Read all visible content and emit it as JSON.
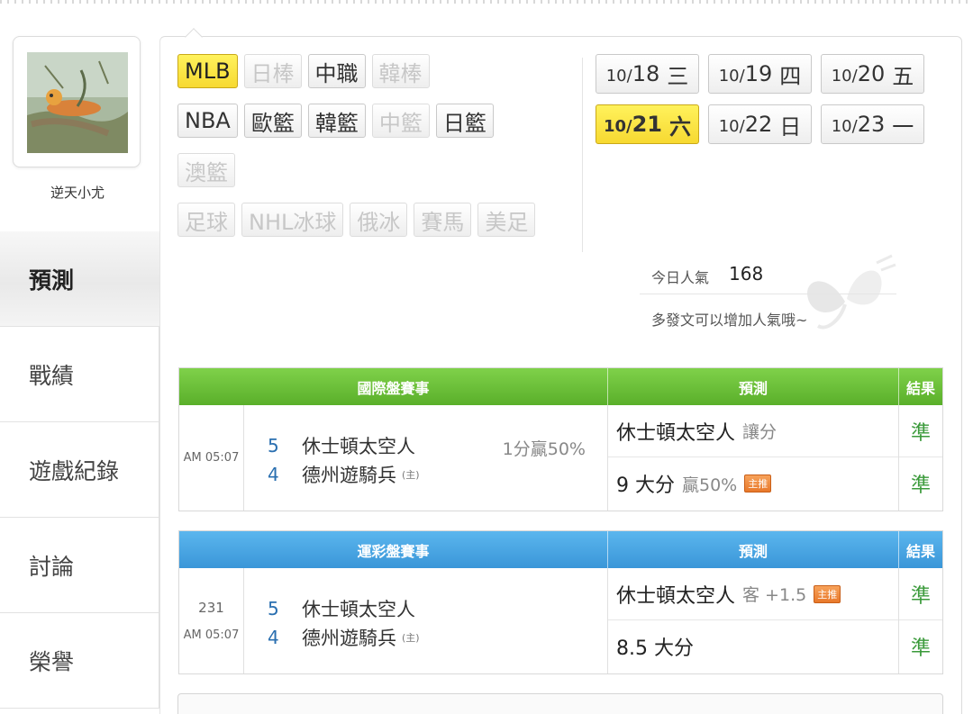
{
  "user": {
    "name": "逆天小尤"
  },
  "sidebar": {
    "items": [
      {
        "label": "預測",
        "active": true
      },
      {
        "label": "戰績"
      },
      {
        "label": "遊戲紀錄"
      },
      {
        "label": "討論"
      },
      {
        "label": "榮譽"
      }
    ]
  },
  "leagues": {
    "row1": [
      {
        "label": "MLB",
        "state": "selected"
      },
      {
        "label": "日棒",
        "state": "disabled"
      },
      {
        "label": "中職",
        "state": "normal"
      },
      {
        "label": "韓棒",
        "state": "disabled"
      }
    ],
    "row2": [
      {
        "label": "NBA",
        "state": "normal"
      },
      {
        "label": "歐籃",
        "state": "normal"
      },
      {
        "label": "韓籃",
        "state": "normal"
      },
      {
        "label": "中籃",
        "state": "disabled"
      },
      {
        "label": "日籃",
        "state": "normal"
      }
    ],
    "row3": [
      {
        "label": "澳籃",
        "state": "disabled"
      }
    ],
    "row4": [
      {
        "label": "足球",
        "state": "disabled"
      },
      {
        "label": "NHL冰球",
        "state": "disabled"
      },
      {
        "label": "俄冰",
        "state": "disabled"
      },
      {
        "label": "賽馬",
        "state": "disabled"
      },
      {
        "label": "美足",
        "state": "disabled"
      }
    ]
  },
  "dates": {
    "row1": [
      {
        "month": "10/",
        "day": "18",
        "weekday": "三"
      },
      {
        "month": "10/",
        "day": "19",
        "weekday": "四"
      },
      {
        "month": "10/",
        "day": "20",
        "weekday": "五"
      }
    ],
    "row2": [
      {
        "month": "10/",
        "day": "21",
        "weekday": "六",
        "selected": true
      },
      {
        "month": "10/",
        "day": "22",
        "weekday": "日"
      },
      {
        "month": "10/",
        "day": "23",
        "weekday": "一"
      }
    ]
  },
  "popularity": {
    "label": "今日人氣",
    "value": "168",
    "hint": "多發文可以增加人氣哦~"
  },
  "intl_table": {
    "headers": {
      "game": "國際盤賽事",
      "pred": "預測",
      "result": "結果"
    },
    "time": "AM 05:07",
    "away": {
      "score": "5",
      "team": "休士頓太空人"
    },
    "home": {
      "score": "4",
      "team": "德州遊騎兵",
      "tag": "(主)"
    },
    "handicap": "1分贏50%",
    "predictions": [
      {
        "main": "休士頓太空人",
        "sub": "讓分",
        "badge": "",
        "result": "準"
      },
      {
        "main": "9 大分",
        "sub": "贏50%",
        "badge": "主推",
        "result": "準"
      }
    ]
  },
  "sports_table": {
    "headers": {
      "game": "運彩盤賽事",
      "pred": "預測",
      "result": "結果"
    },
    "game_no": "231",
    "time": "AM 05:07",
    "away": {
      "score": "5",
      "team": "休士頓太空人"
    },
    "home": {
      "score": "4",
      "team": "德州遊騎兵",
      "tag": "(主)"
    },
    "predictions": [
      {
        "main": "休士頓太空人",
        "sub": "客 +1.5",
        "badge": "主推",
        "result": "準"
      },
      {
        "main": "8.5 大分",
        "sub": "",
        "badge": "",
        "result": "準"
      }
    ]
  }
}
